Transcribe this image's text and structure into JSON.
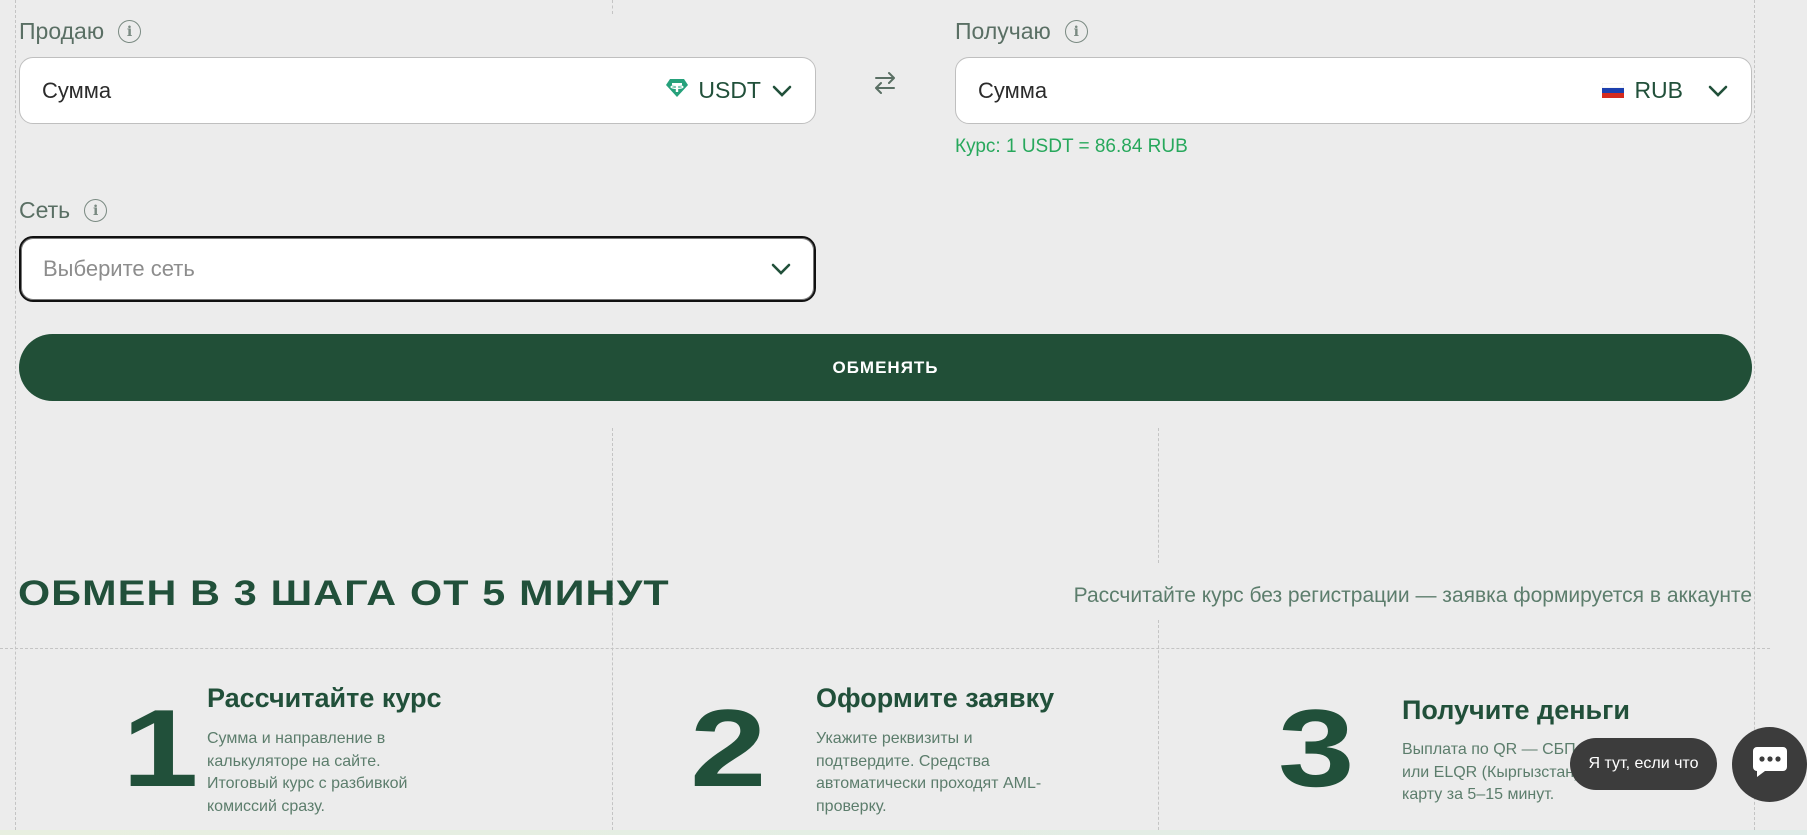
{
  "sell": {
    "label": "Продаю",
    "amount_placeholder": "Сумма",
    "currency": "USDT"
  },
  "receive": {
    "label": "Получаю",
    "amount_placeholder": "Сумма",
    "currency": "RUB"
  },
  "rate": "Курс: 1 USDT = 86.84 RUB",
  "network": {
    "label": "Сеть",
    "placeholder": "Выберите сеть"
  },
  "exchange_button": "ОБМЕНЯТЬ",
  "steps_section": {
    "title": "ОБМЕН В 3 ШАГА ОТ 5 МИНУТ",
    "subtitle": "Рассчитайте курс без регистрации — заявка формируется в аккаунте",
    "steps": [
      {
        "number": "1",
        "title": "Рассчитайте курс",
        "lines": [
          "Сумма и направление в",
          "калькуляторе на сайте.",
          "Итоговый курс с разбивкой",
          "комиссий сразу."
        ]
      },
      {
        "number": "2",
        "title": "Оформите заявку",
        "lines": [
          "Укажите реквизиты и",
          "подтвердите. Средства",
          "автоматически проходят AML-",
          "проверку."
        ]
      },
      {
        "number": "3",
        "title": "Получите деньги",
        "lines": [
          "Выплата по QR — СБП",
          "или ELQR (Кыргызстан)",
          "карту за 5–15 минут."
        ]
      }
    ]
  },
  "chat": {
    "bubble_text": "Я тут, если что"
  },
  "colors": {
    "brand_green": "#214f37",
    "rate_green": "#27a85c",
    "tether_teal": "#26a17b"
  }
}
